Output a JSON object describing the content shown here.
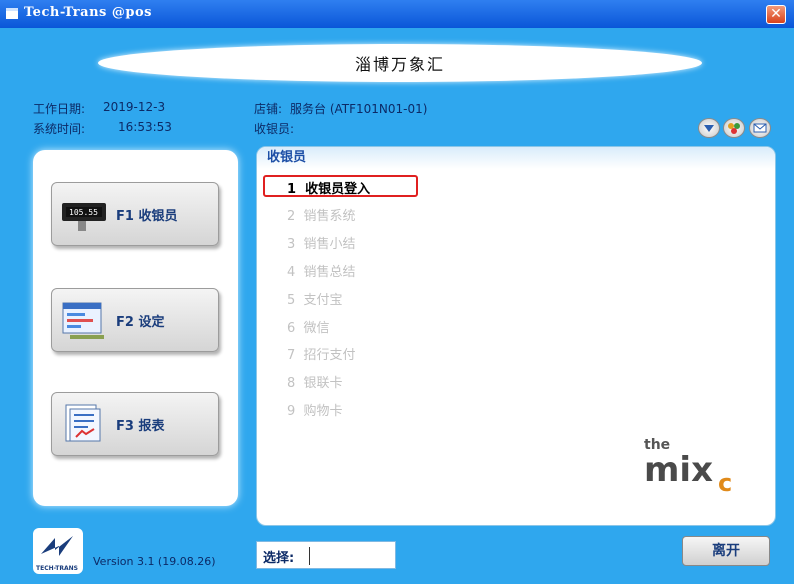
{
  "window": {
    "title": "Tech-Trans @pos",
    "close_glyph": "✕"
  },
  "banner": {
    "text": "淄博万象汇"
  },
  "info": {
    "work_date_label": "工作日期:",
    "work_date": "2019-12-3",
    "system_time_label": "系统时间:",
    "system_time": "16:53:53",
    "store_label": "店铺:",
    "store": "服务台 (ATF101N01-01)",
    "cashier_label": "收银员:",
    "cashier": ""
  },
  "toolbar_icons": [
    "down-arrow-icon",
    "users-icon",
    "mail-icon"
  ],
  "function_buttons": [
    {
      "label": "F1 收银员",
      "icon": "cash-register-icon"
    },
    {
      "label": "F2 设定",
      "icon": "settings-window-icon"
    },
    {
      "label": "F3 报表",
      "icon": "report-icon"
    }
  ],
  "menu": {
    "header": "收银员",
    "items": [
      {
        "num": "1",
        "label": "收银员登入",
        "active": true
      },
      {
        "num": "2",
        "label": "销售系统",
        "active": false
      },
      {
        "num": "3",
        "label": "销售小结",
        "active": false
      },
      {
        "num": "4",
        "label": "销售总结",
        "active": false
      },
      {
        "num": "5",
        "label": "支付宝",
        "active": false
      },
      {
        "num": "6",
        "label": "微信",
        "active": false
      },
      {
        "num": "7",
        "label": "招行支付",
        "active": false
      },
      {
        "num": "8",
        "label": "银联卡",
        "active": false
      },
      {
        "num": "9",
        "label": "购物卡",
        "active": false
      }
    ]
  },
  "logo": {
    "line1": "the",
    "mark": "mix",
    "sub": "c"
  },
  "footer": {
    "brand": "TECH-TRANS",
    "version": "Version 3.1 (19.08.26)",
    "select_label": "选择:",
    "select_value": "",
    "leave_label": "离开"
  },
  "colors": {
    "window_bg": "#2fa7ee",
    "title_bar": "#0a56d8",
    "menu_header_text": "#1c4ea6",
    "highlight": "#e02020"
  }
}
